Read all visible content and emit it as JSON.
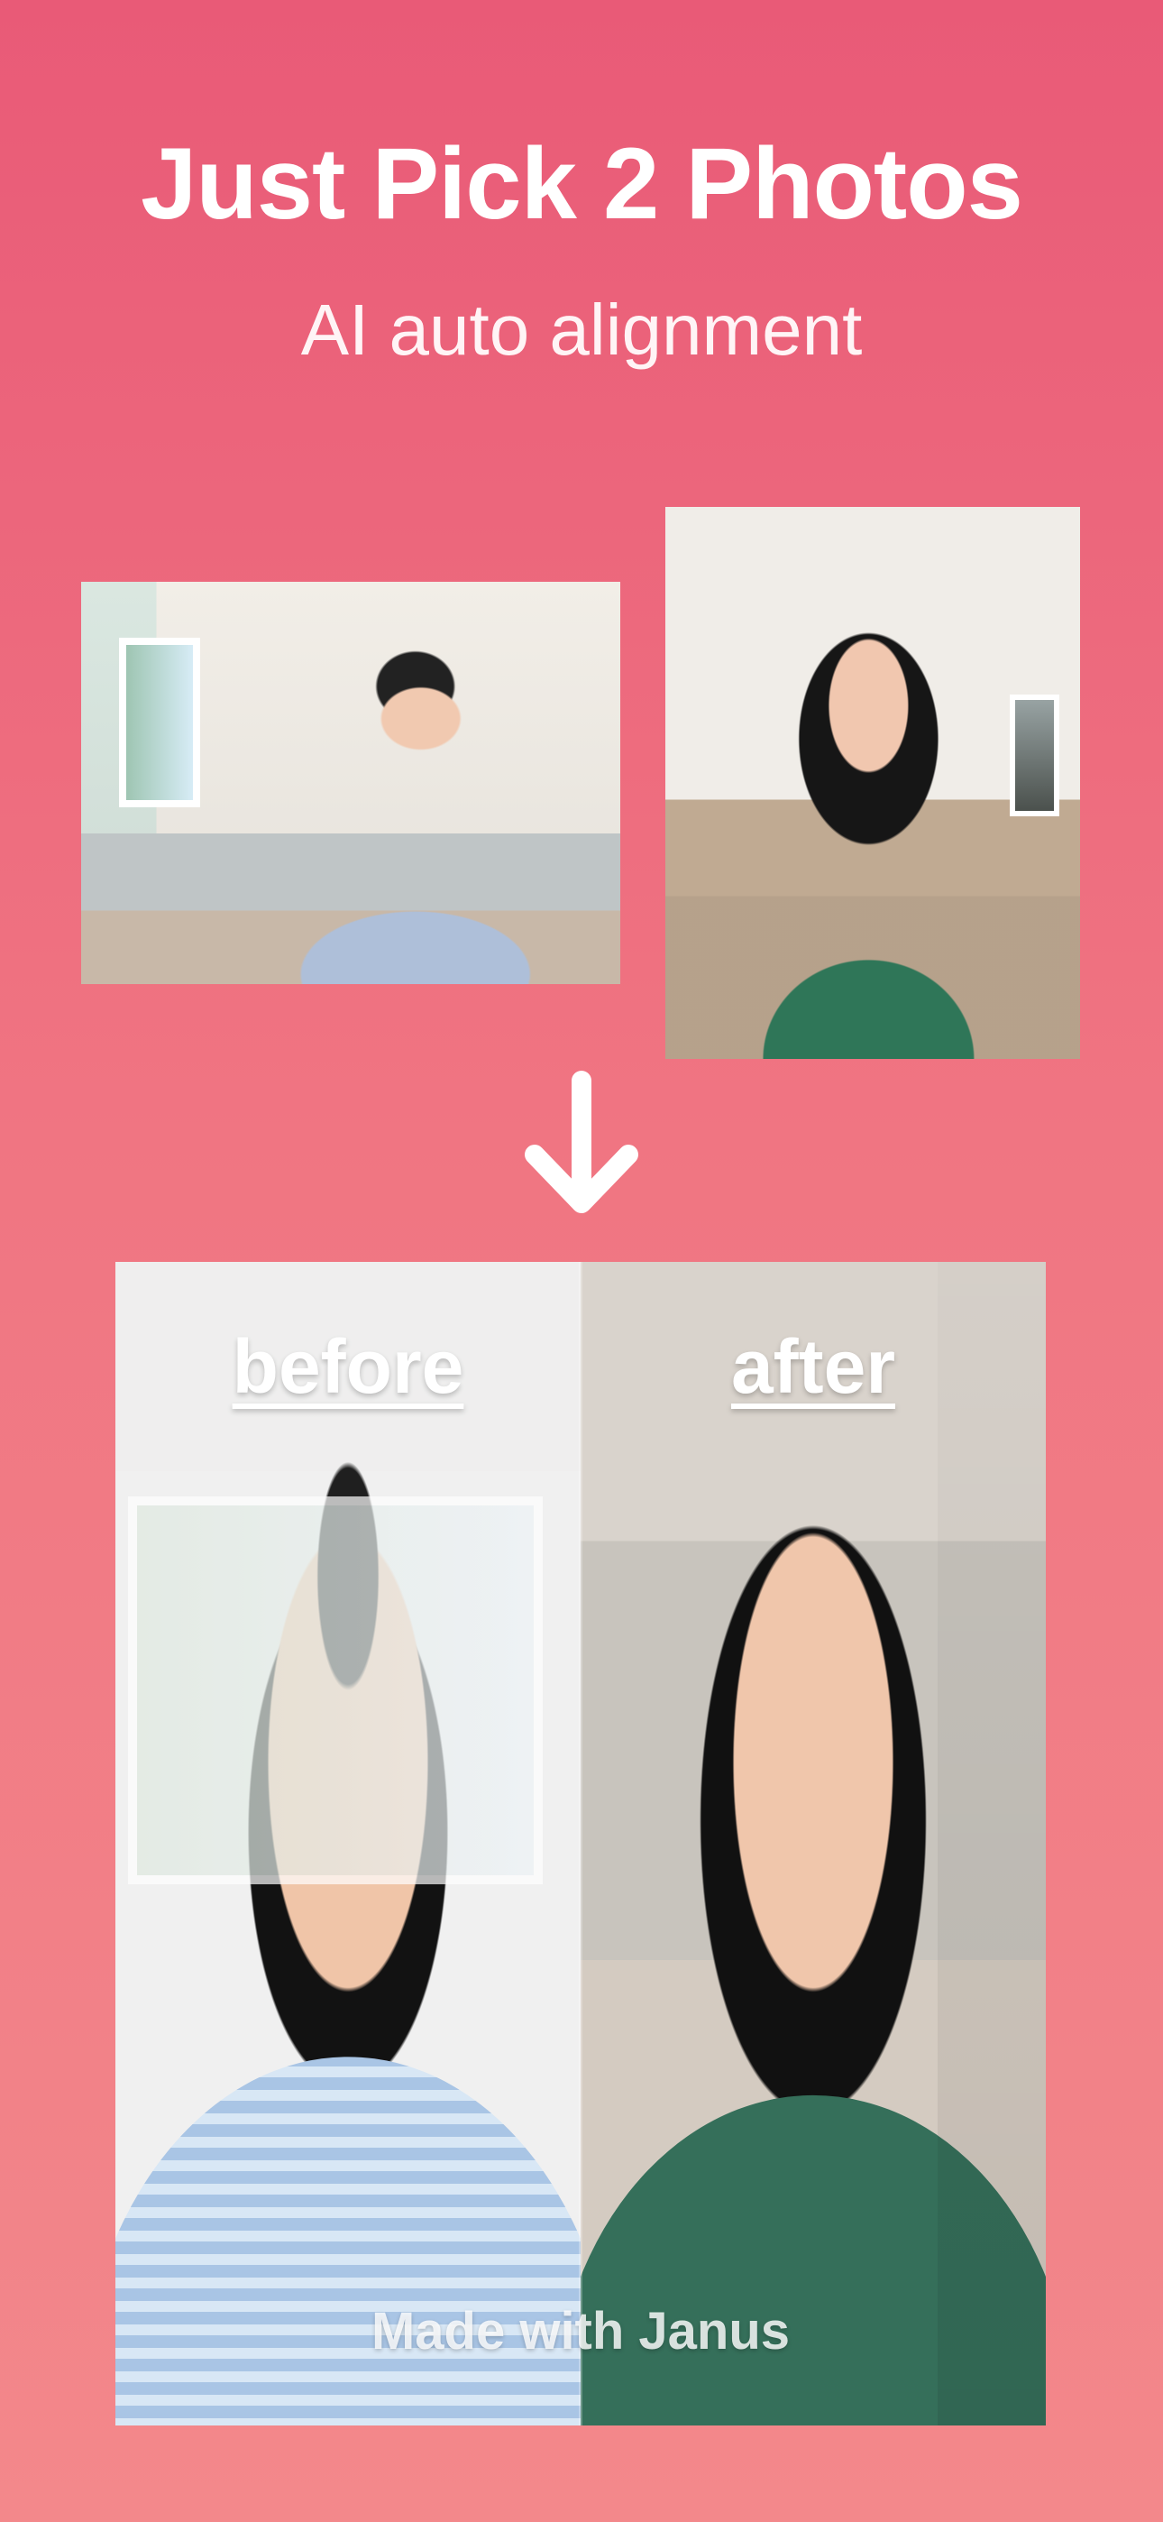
{
  "hero": {
    "headline": "Just Pick 2 Photos",
    "subheadline": "AI auto alignment"
  },
  "comparison": {
    "before_label": "before",
    "after_label": "after",
    "watermark": "Made with Janus"
  },
  "icons": {
    "arrow": "arrow-down-icon"
  },
  "colors": {
    "background_top": "#e95a77",
    "background_bottom": "#f3888b",
    "text": "#ffffff"
  }
}
